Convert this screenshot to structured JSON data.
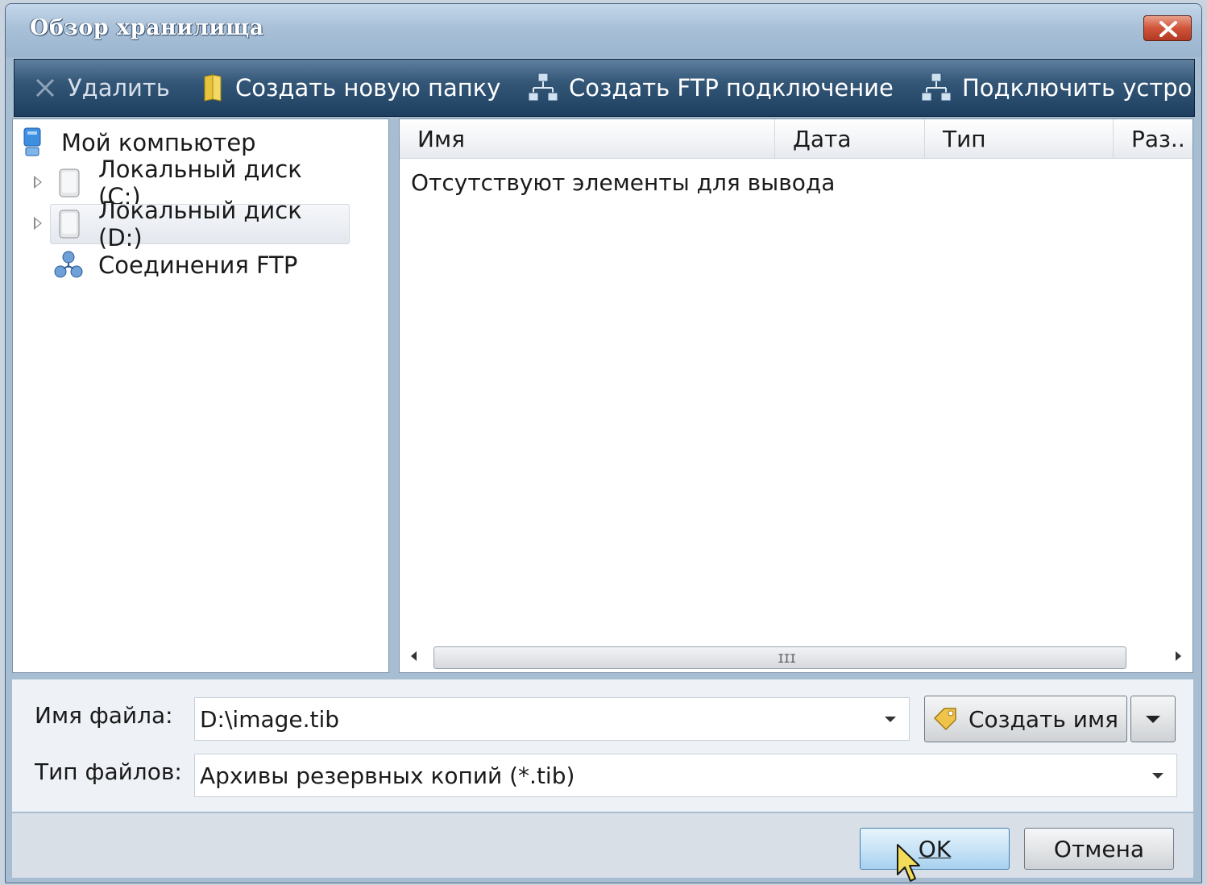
{
  "window": {
    "title": "Обзор хранилища"
  },
  "toolbar": {
    "items": [
      {
        "label": "Удалить",
        "icon": "delete-x-icon",
        "enabled": false
      },
      {
        "label": "Создать новую папку",
        "icon": "folder-icon",
        "enabled": true
      },
      {
        "label": "Создать FTP подключение",
        "icon": "network-icon",
        "enabled": true
      },
      {
        "label": "Подключить устрой",
        "icon": "network-icon",
        "enabled": true
      }
    ]
  },
  "tree": {
    "root": {
      "label": "Мой компьютер",
      "icon": "computer-icon"
    },
    "items": [
      {
        "label": "Локальный диск (C:)",
        "icon": "drive-icon",
        "expandable": true,
        "selected": false
      },
      {
        "label": "Локальный диск (D:)",
        "icon": "drive-icon",
        "expandable": true,
        "selected": true
      },
      {
        "label": "Соединения FTP",
        "icon": "ftp-network-icon",
        "expandable": false,
        "selected": false
      }
    ]
  },
  "list": {
    "columns": [
      "Имя",
      "Дата",
      "Тип",
      "Раз.."
    ],
    "empty_message": "Отсутствуют элементы для вывода",
    "scroll_grip": "III"
  },
  "form": {
    "filename_label": "Имя файла:",
    "filename_value": "D:\\image.tib",
    "filetype_label": "Тип файлов:",
    "filetype_value": "Архивы резервных копий (*.tib)",
    "generate_name_label": "Создать имя"
  },
  "buttons": {
    "ok": "OK",
    "cancel": "Отмена"
  },
  "colors": {
    "toolbar_bg": "#1d3e60",
    "title_bg": "#a8c0d8",
    "close_red": "#d0543a",
    "ok_blue": "#c9e4f7"
  }
}
